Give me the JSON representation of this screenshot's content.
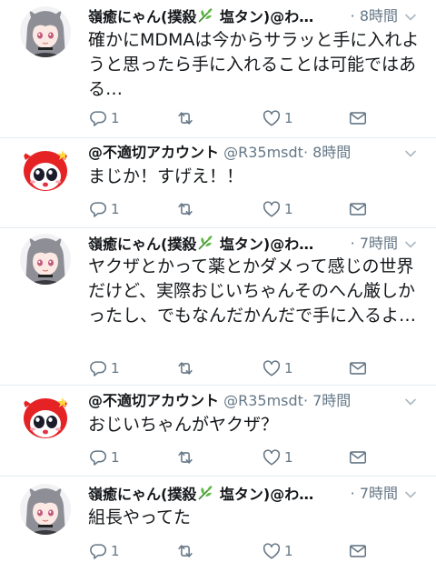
{
  "tweets": [
    {
      "name": "嶺癒にゃん(撲殺",
      "name_suffix": " 塩タン)@わ…",
      "handle": "",
      "time": "· 8時間",
      "text": "確かにMDMAは今からサラッと手に入れようと思ったら手に入れることは可能ではある…",
      "reply_count": "1",
      "retweet_count": "",
      "like_count": "1"
    },
    {
      "name": "@不適切アカウント",
      "name_suffix": "",
      "handle": "@R35msdt",
      "time": "· 8時間",
      "text": "まじか！すげえ！！",
      "reply_count": "1",
      "retweet_count": "",
      "like_count": "1"
    },
    {
      "name": "嶺癒にゃん(撲殺",
      "name_suffix": " 塩タン)@わ…",
      "handle": "",
      "time": "· 7時間",
      "text": "ヤクザとかって薬とかダメって感じの世界だけど、実際おじいちゃんそのへん厳しかったし、でもなんだかんだで手に入るよ…",
      "reply_count": "1",
      "retweet_count": "",
      "like_count": "1"
    },
    {
      "name": "@不適切アカウント",
      "name_suffix": "",
      "handle": "@R35msdt",
      "time": "· 7時間",
      "text": "おじいちゃんがヤクザ？",
      "reply_count": "1",
      "retweet_count": "",
      "like_count": "1"
    },
    {
      "name": "嶺癒にゃん(撲殺",
      "name_suffix": " 塩タン)@わ…",
      "handle": "",
      "time": "· 7時間",
      "text": "組長やってた",
      "reply_count": "1",
      "retweet_count": "",
      "like_count": "1"
    }
  ],
  "colors": {
    "text": "#14171a",
    "secondary": "#657786",
    "separator": "#e6ecf0",
    "icon": "#657786"
  },
  "icons": [
    "reply-icon",
    "retweet-icon",
    "like-icon",
    "share-icon",
    "caret-down-icon",
    "leaf-emoji-icon"
  ]
}
